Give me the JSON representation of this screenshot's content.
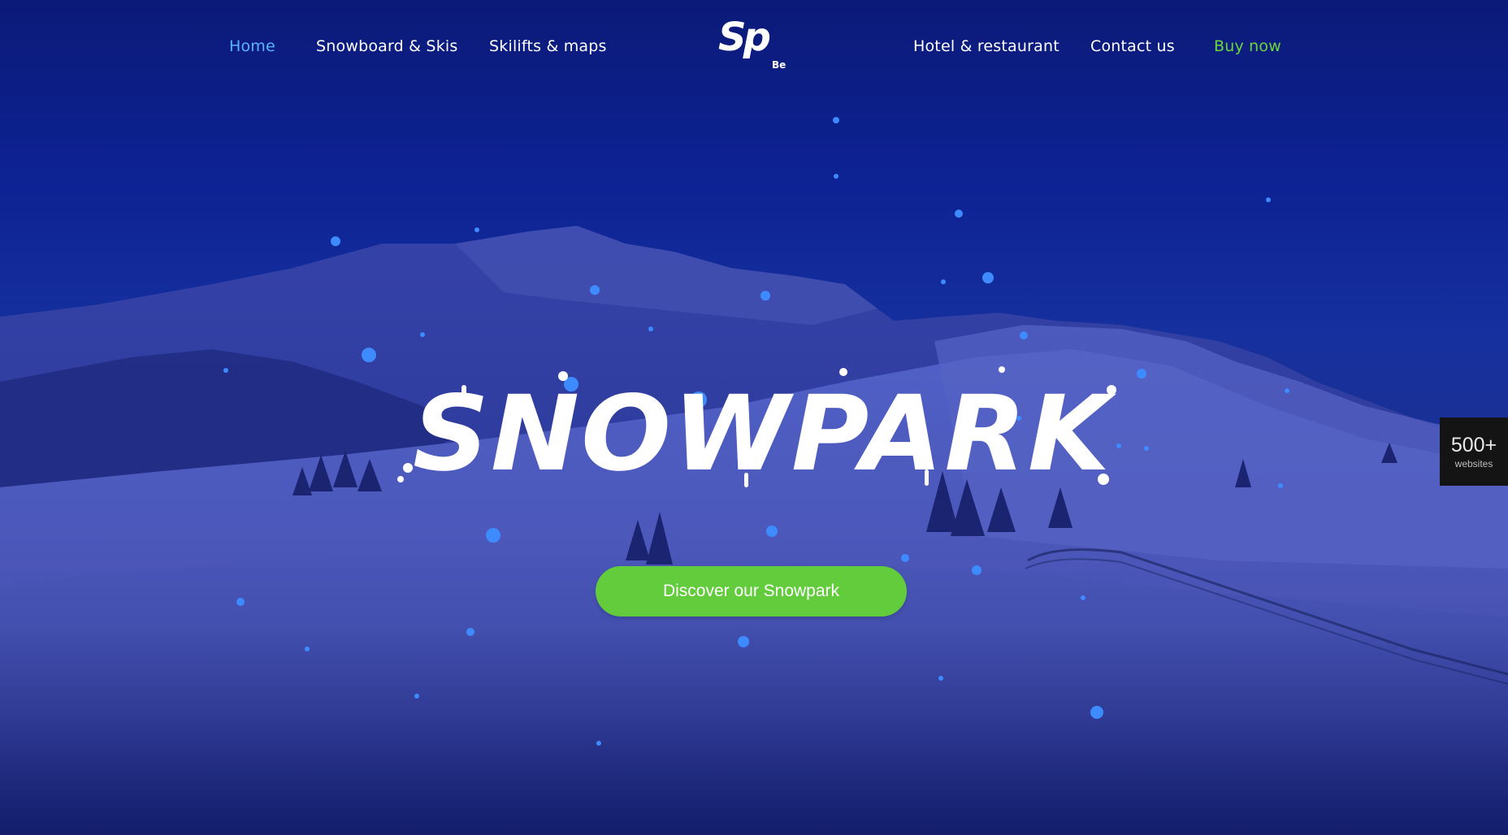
{
  "nav": {
    "left": [
      {
        "label": "Home",
        "active": true
      },
      {
        "label": "Snowboard & Skis",
        "active": false
      },
      {
        "label": "Skilifts & maps",
        "active": false
      }
    ],
    "right": [
      {
        "label": "Hotel & restaurant"
      },
      {
        "label": "Contact us"
      },
      {
        "label": "Buy now"
      }
    ]
  },
  "logo": {
    "main": "Sp",
    "sub": "Be"
  },
  "hero": {
    "headline": "SNOWPARK",
    "cta_label": "Discover our Snowpark"
  },
  "side_badge": {
    "count": "500+",
    "label": "websites"
  },
  "colors": {
    "sky_top": "#0b1a78",
    "active_link": "#5ab4ff",
    "buy_link": "#6ad63e",
    "cta": "#62cc3c",
    "snowflake": "#3d8bff"
  },
  "icons": [
    "snowflake-dot",
    "mountain-scene"
  ]
}
